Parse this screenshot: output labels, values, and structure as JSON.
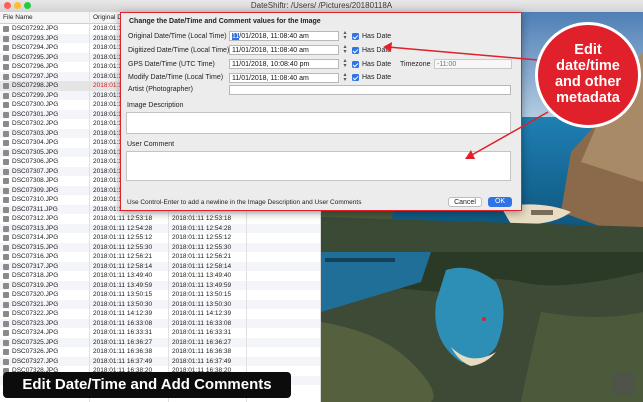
{
  "window": {
    "title": "DateShiftr: /Users/     /Pictures/20180118A"
  },
  "table": {
    "columns": [
      "File Name",
      "Original D",
      ""
    ],
    "rows": [
      [
        "DSC07292.JPG",
        "2018:01:1",
        ""
      ],
      [
        "DSC07293.JPG",
        "2018:01:1",
        ""
      ],
      [
        "DSC07294.JPG",
        "2018:01:1",
        ""
      ],
      [
        "DSC07295.JPG",
        "2018:01:1",
        ""
      ],
      [
        "DSC07296.JPG",
        "2018:01:1",
        ""
      ],
      [
        "DSC07297.JPG",
        "2018:01:1",
        ""
      ],
      [
        "DSC07298.JPG",
        "2018:01:1",
        ""
      ],
      [
        "DSC07299.JPG",
        "2018:01:1",
        ""
      ],
      [
        "DSC07300.JPG",
        "2018:01:1",
        ""
      ],
      [
        "DSC07301.JPG",
        "2018:01:1",
        ""
      ],
      [
        "DSC07302.JPG",
        "2018:01:1",
        ""
      ],
      [
        "DSC07303.JPG",
        "2018:01:1",
        ""
      ],
      [
        "DSC07304.JPG",
        "2018:01:1",
        ""
      ],
      [
        "DSC07305.JPG",
        "2018:01:1",
        ""
      ],
      [
        "DSC07306.JPG",
        "2018:01:1",
        ""
      ],
      [
        "DSC07307.JPG",
        "2018:01:1",
        ""
      ],
      [
        "DSC07308.JPG",
        "2018:01:1",
        ""
      ],
      [
        "DSC07309.JPG",
        "2018:01:1",
        ""
      ],
      [
        "DSC07310.JPG",
        "2018:01:1",
        ""
      ],
      [
        "DSC07311.JPG",
        "2018:01:1",
        ""
      ],
      [
        "DSC07312.JPG",
        "2018:01:11 12:53:18",
        "2018:01:11 12:53:18"
      ],
      [
        "DSC07313.JPG",
        "2018:01:11 12:54:28",
        "2018:01:11 12:54:28"
      ],
      [
        "DSC07314.JPG",
        "2018:01:11 12:55:12",
        "2018:01:11 12:55:12"
      ],
      [
        "DSC07315.JPG",
        "2018:01:11 12:55:30",
        "2018:01:11 12:55:30"
      ],
      [
        "DSC07316.JPG",
        "2018:01:11 12:56:21",
        "2018:01:11 12:56:21"
      ],
      [
        "DSC07317.JPG",
        "2018:01:11 12:58:14",
        "2018:01:11 12:58:14"
      ],
      [
        "DSC07318.JPG",
        "2018:01:11 13:49:40",
        "2018:01:11 13:49:40"
      ],
      [
        "DSC07319.JPG",
        "2018:01:11 13:49:59",
        "2018:01:11 13:49:59"
      ],
      [
        "DSC07320.JPG",
        "2018:01:11 13:50:15",
        "2018:01:11 13:50:15"
      ],
      [
        "DSC07321.JPG",
        "2018:01:11 13:50:30",
        "2018:01:11 13:50:30"
      ],
      [
        "DSC07322.JPG",
        "2018:01:11 14:12:39",
        "2018:01:11 14:12:39"
      ],
      [
        "DSC07323.JPG",
        "2018:01:11 16:33:08",
        "2018:01:11 16:33:08"
      ],
      [
        "DSC07324.JPG",
        "2018:01:11 16:33:31",
        "2018:01:11 16:33:31"
      ],
      [
        "DSC07325.JPG",
        "2018:01:11 16:36:27",
        "2018:01:11 16:36:27"
      ],
      [
        "DSC07326.JPG",
        "2018:01:11 16:36:38",
        "2018:01:11 16:36:38"
      ],
      [
        "DSC07327.JPG",
        "2018:01:11 16:37:49",
        "2018:01:11 16:37:49"
      ],
      [
        "DSC07328.JPG",
        "2018:01:11 16:38:20",
        "2018:01:11 16:38:20"
      ],
      [
        "DSC07329.JPG",
        "2018:01:11 16:42:05",
        "2018:01:11 16:42:05"
      ]
    ],
    "selected_index": 6
  },
  "dialog": {
    "title": "Change the Date/Time and Comment values for the Image",
    "original_label": "Original Date/Time (Local Time)",
    "original_value_highlight": "11",
    "original_value_rest": "/01/2018, 11:08:40 am",
    "digitized_label": "Digitized Date/Time (Local Time)",
    "digitized_value": "11/01/2018, 11:08:40 am",
    "gps_label": "GPS Date/Time (UTC Time)",
    "gps_value": "11/01/2018, 10:08:40 pm",
    "modify_label": "Modify Date/Time (Local Time)",
    "modify_value": "11/01/2018, 11:08:40 am",
    "has_date_label": "Has Date",
    "timezone_label": "Timezone",
    "timezone_placeholder": "-11:00",
    "artist_label": "Artist (Photographer)",
    "artist_value": "",
    "image_description_label": "Image Description",
    "user_comment_label": "User Comment",
    "hint": "Use Control-Enter to add a newline in the Image Description and User Comments",
    "cancel_label": "Cancel",
    "ok_label": "OK"
  },
  "callout": {
    "lines": [
      "Edit",
      "date/time",
      "and other",
      "metadata"
    ],
    "color": "#e0202a"
  },
  "banner": {
    "text": "Edit Date/Time and Add Comments"
  },
  "colors": {
    "accent": "#2f73e6",
    "highlight": "#e0202a"
  }
}
